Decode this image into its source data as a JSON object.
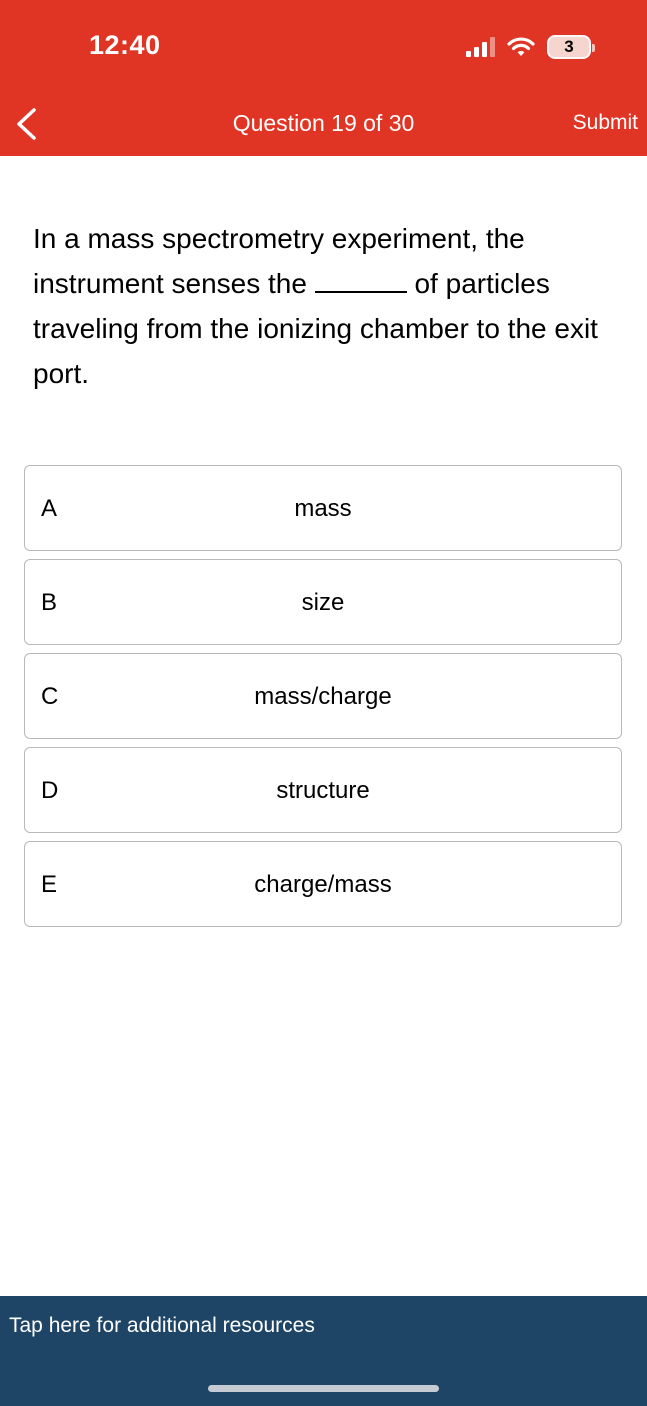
{
  "status_bar": {
    "time": "12:40",
    "battery_level": "3",
    "icons": [
      "signal-icon",
      "wifi-icon",
      "battery-icon"
    ]
  },
  "nav": {
    "back_icon": "chevron-left-icon",
    "title": "Question 19 of 30",
    "submit_label": "Submit"
  },
  "question": {
    "text_before": "In a mass spectrometry experiment, the instrument senses the",
    "text_after": "of particles traveling from the ionizing chamber to the exit port."
  },
  "options": [
    {
      "letter": "A",
      "text": "mass"
    },
    {
      "letter": "B",
      "text": "size"
    },
    {
      "letter": "C",
      "text": "mass/charge"
    },
    {
      "letter": "D",
      "text": "structure"
    },
    {
      "letter": "E",
      "text": "charge/mass"
    }
  ],
  "footer": {
    "resources_label": "Tap here for additional resources"
  },
  "colors": {
    "header_bg": "#e03424",
    "footer_bg": "#1f4566",
    "option_border": "#b9b9b9"
  }
}
